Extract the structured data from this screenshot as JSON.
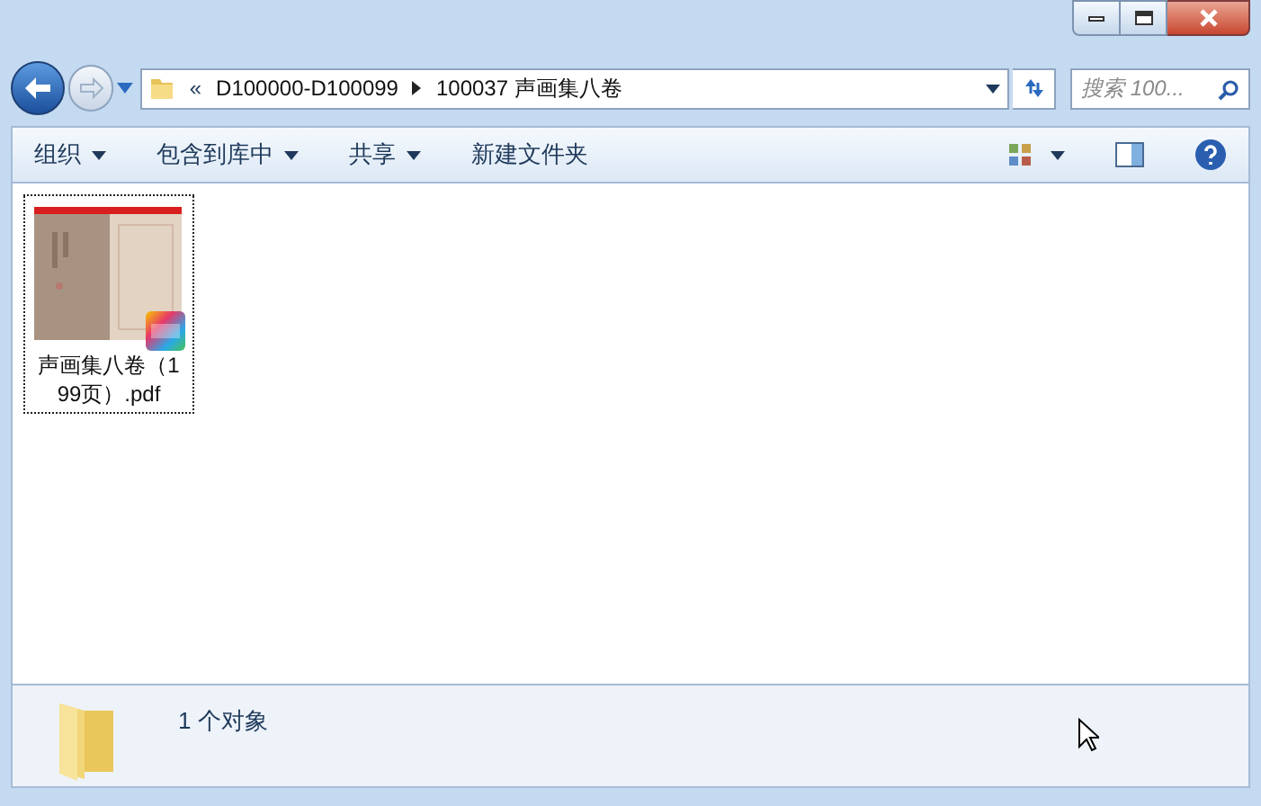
{
  "address_bar": {
    "overflow": "«",
    "crumbs": [
      "D100000-D100099",
      "100037 声画集八卷"
    ]
  },
  "search": {
    "placeholder": "搜索 100..."
  },
  "toolbar": {
    "menus": [
      {
        "label": "组织",
        "dropdown": true
      },
      {
        "label": "包含到库中",
        "dropdown": true
      },
      {
        "label": "共享",
        "dropdown": true
      },
      {
        "label": "新建文件夹",
        "dropdown": false
      }
    ]
  },
  "files": [
    {
      "name": "声画集八卷（199页）.pdf",
      "focused": true,
      "kind": "pdf"
    }
  ],
  "status_bar": {
    "text": "1 个对象"
  }
}
